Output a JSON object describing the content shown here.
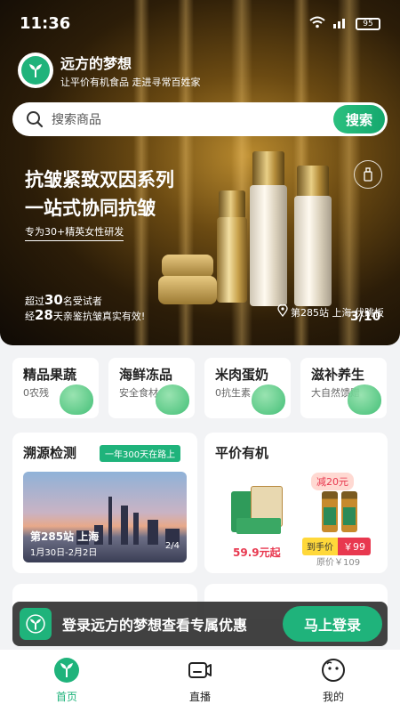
{
  "status_bar": {
    "time": "11:36",
    "battery": "95"
  },
  "brand": {
    "name": "远方的梦想",
    "slogan": "让平价有机食品 走进寻常百姓家"
  },
  "search": {
    "placeholder": "搜索商品",
    "button": "搜索"
  },
  "hero": {
    "headline_line1": "抗皱紧致双因系列",
    "headline_line2": "一站式协同抗皱",
    "sub": "专为30+精英女性研发",
    "stat1_prefix": "超过",
    "stat1_num": "30",
    "stat1_suffix": "名受试者",
    "stat2_prefix": "经",
    "stat2_num": "28",
    "stat2_suffix": "天亲鉴抗皱真实有效!",
    "location": "第285站 上海 伏跳板",
    "page": "3/10"
  },
  "categories": [
    {
      "title": "精品果蔬",
      "sub": "0农残",
      "icon": "vegetable-icon"
    },
    {
      "title": "海鲜冻品",
      "sub": "安全食材",
      "icon": "fish-icon"
    },
    {
      "title": "米肉蛋奶",
      "sub": "0抗生素",
      "icon": "bowl-icon"
    },
    {
      "title": "滋补养生",
      "sub": "大自然馈赠",
      "icon": "bottle-icon"
    }
  ],
  "trace_card": {
    "title": "溯源检测",
    "tag": "一年300天在路上",
    "station": "第285站 上海",
    "date": "1月30日-2月2日",
    "page": "2/4"
  },
  "price_card": {
    "title": "平价有机",
    "price_a": "59.9元起",
    "discount": "减20元",
    "deal_label": "到手价",
    "deal_price": "￥99",
    "orig_price": "原价￥109"
  },
  "login": {
    "text": "登录远方的梦想查看专属优惠",
    "button": "马上登录"
  },
  "tabs": [
    {
      "label": "首页",
      "icon": "home-sprout-icon",
      "active": true
    },
    {
      "label": "直播",
      "icon": "live-camera-icon",
      "active": false
    },
    {
      "label": "我的",
      "icon": "profile-face-icon",
      "active": false
    }
  ],
  "colors": {
    "brand_green": "#1fb37b",
    "price_red": "#e8384f"
  }
}
